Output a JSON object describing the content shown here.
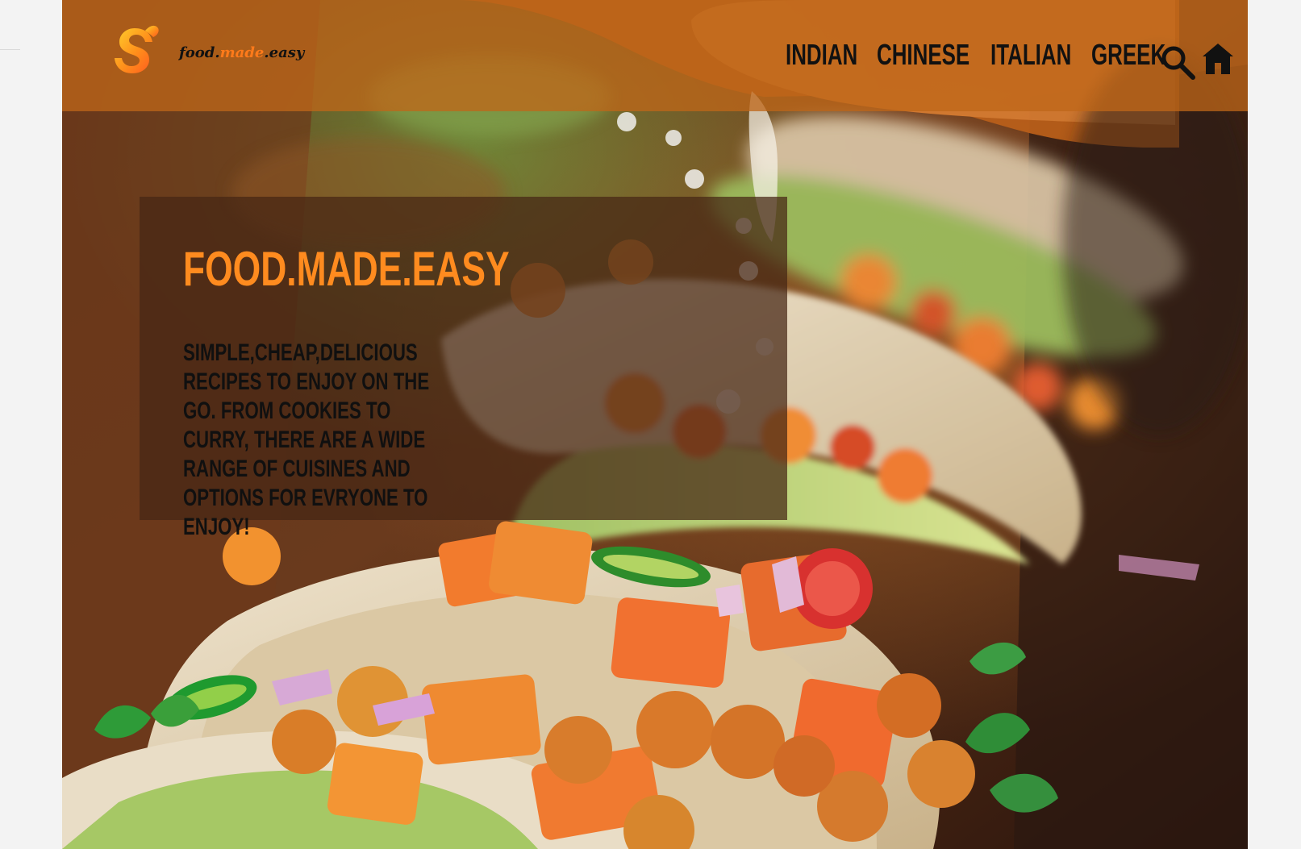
{
  "brand": {
    "name_prefix": "food.",
    "name_middle": "made",
    "name_suffix": ".easy",
    "accent_color": "#ff7a1a"
  },
  "nav": {
    "items": [
      {
        "label": "INDIAN"
      },
      {
        "label": "CHINESE"
      },
      {
        "label": "ITALIAN"
      },
      {
        "label": "GREEK"
      }
    ]
  },
  "header": {
    "icons": [
      {
        "name": "search-icon"
      },
      {
        "name": "home-icon"
      }
    ]
  },
  "hero": {
    "title": "FOOD.MADE.EASY",
    "description": "SIMPLE,CHEAP,DELICIOUS RECIPES TO ENJOY ON THE GO. FROM COOKIES TO CURRY, THERE ARE A WIDE RANGE OF CUISINES AND OPTIONS FOR EVRYONE TO ENJOY!"
  },
  "colors": {
    "header_overlay": "#bf6719",
    "title": "#ff8b1f",
    "panel_overlay": "#462614"
  }
}
